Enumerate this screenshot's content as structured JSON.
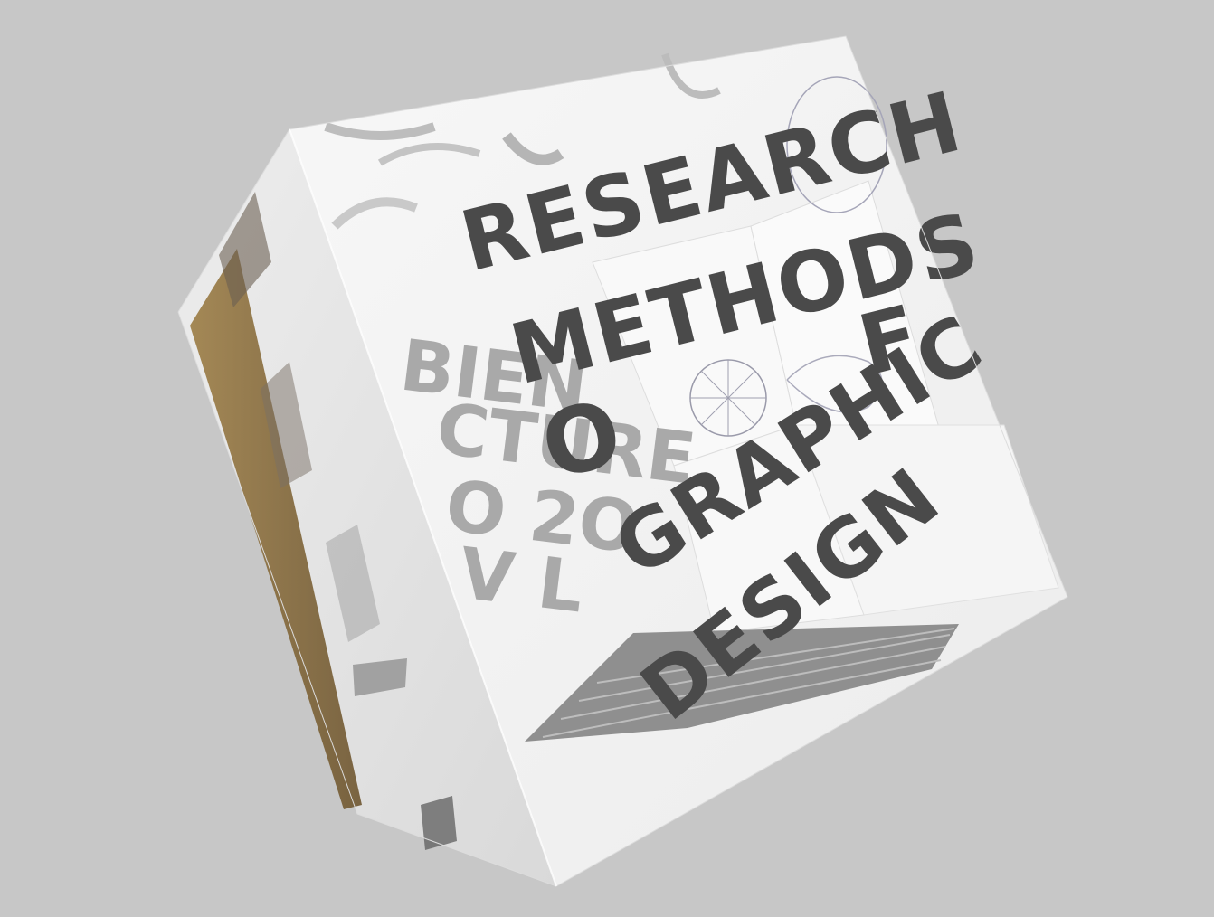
{
  "cube": {
    "title_lines": [
      "RESEARCH",
      "METHODS",
      "O",
      "F",
      "GRAPHIC",
      "DESIGN"
    ],
    "ghost_lines": [
      "BIEN",
      "CTURE",
      "O 2O",
      "V L"
    ],
    "colors": {
      "background": "#c7c7c7",
      "title": "#4a4a4a",
      "front_face": "#f3f3f3",
      "top_face": "#fafafa",
      "left_face": "#e6e6e6",
      "accent_floor": "#8a6f3d"
    }
  }
}
